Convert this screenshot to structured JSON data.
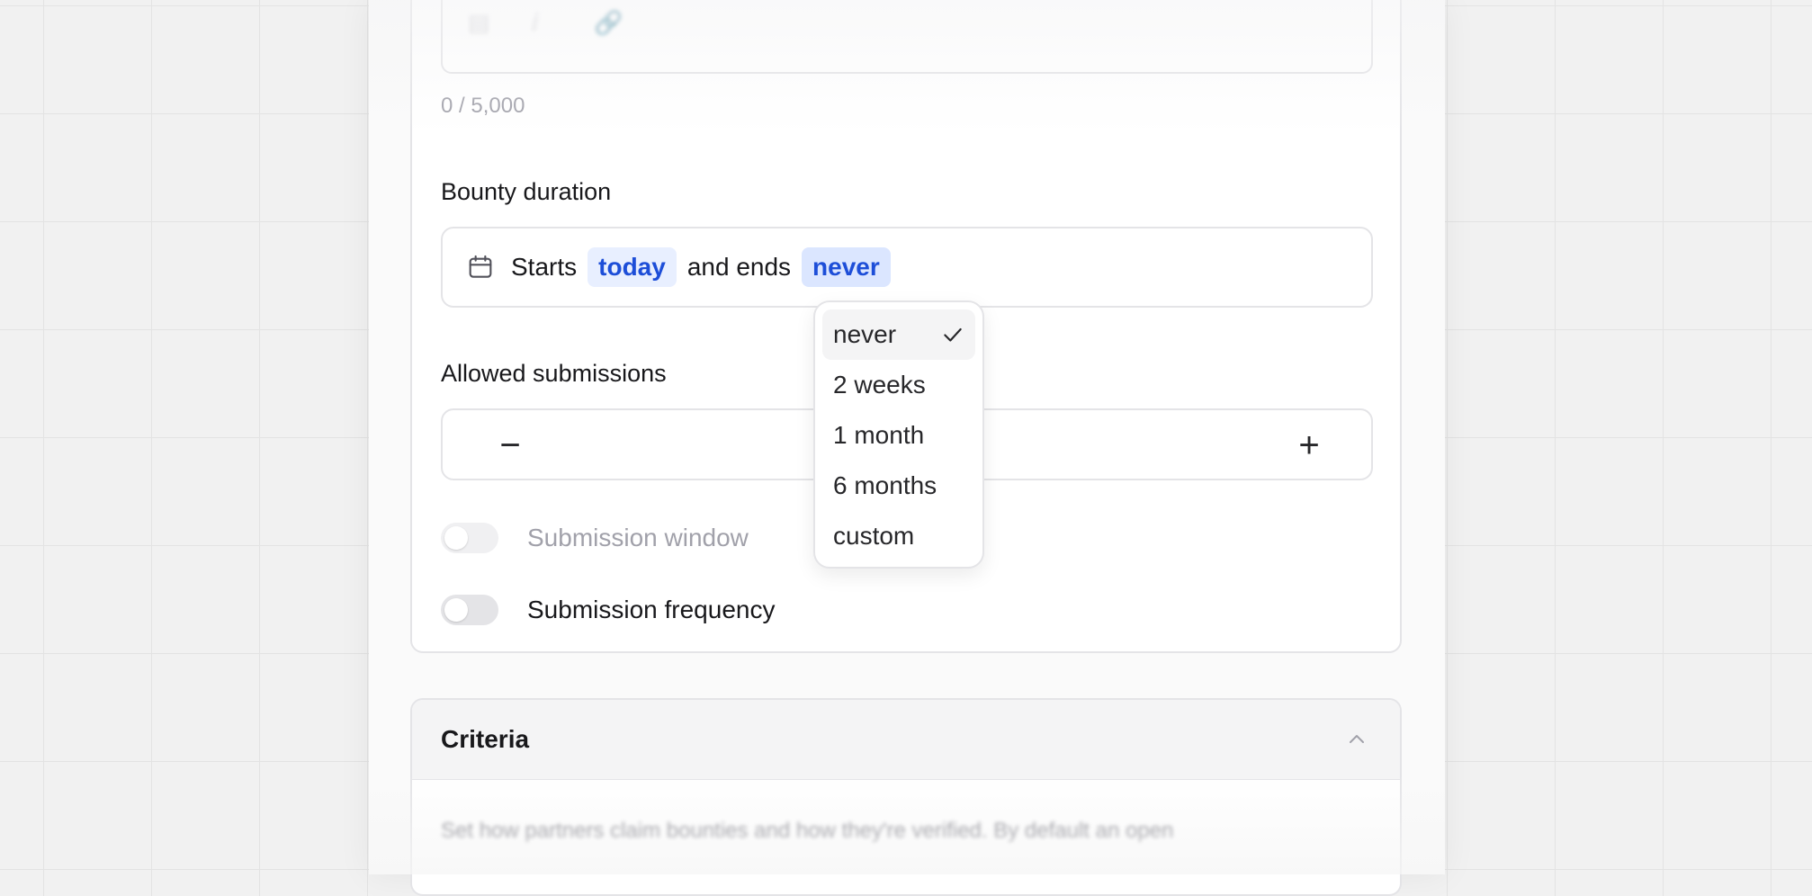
{
  "editor": {
    "counter": "0 / 5,000",
    "toolbar_icons": [
      "bold-icon",
      "italic-icon",
      "link-icon"
    ]
  },
  "duration": {
    "label": "Bounty duration",
    "starts_text": "Starts",
    "start_value": "today",
    "ends_text": "and ends",
    "end_value": "never"
  },
  "dropdown": {
    "options": [
      {
        "label": "never",
        "selected": true
      },
      {
        "label": "2 weeks",
        "selected": false
      },
      {
        "label": "1 month",
        "selected": false
      },
      {
        "label": "6 months",
        "selected": false
      },
      {
        "label": "custom",
        "selected": false
      }
    ]
  },
  "submissions": {
    "label": "Allowed submissions",
    "decrement": "−",
    "increment": "+"
  },
  "toggles": {
    "window": {
      "label": "Submission window",
      "enabled": false,
      "disabled": true
    },
    "frequency": {
      "label": "Submission frequency",
      "enabled": false,
      "disabled": false
    }
  },
  "criteria": {
    "title": "Criteria",
    "description": "Set how partners claim bounties and how they're verified. By default an open"
  },
  "colors": {
    "accent": "#1d4ed8",
    "chip_bg": "#e8efff",
    "border": "#e4e4e7"
  }
}
